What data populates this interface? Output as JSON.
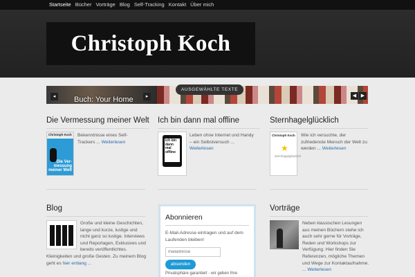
{
  "nav": {
    "items": [
      {
        "label": "Startseite",
        "active": true
      },
      {
        "label": "Bücher"
      },
      {
        "label": "Vorträge"
      },
      {
        "label": "Blog"
      },
      {
        "label": "Self-Tracking"
      },
      {
        "label": "Kontakt"
      },
      {
        "label": "Über mich"
      }
    ]
  },
  "header": {
    "logo_text": "Christoph Koch"
  },
  "slider": {
    "tab_label": "AUSGEWÄHLTE TEXTE",
    "caption": "Buch:  Your Home",
    "prev_icon": "◀",
    "next_icon": "▶",
    "prev_glyph": "◂",
    "next_glyph": "▸"
  },
  "books": [
    {
      "title": "Die Vermessung meiner Welt",
      "text": "Bekenntnisse eines Self-Trackers ... ",
      "more": "Weiterlesen",
      "cover_author": "Christoph Koch",
      "cover_title": "Die Ver-messung meiner Welt"
    },
    {
      "title": "Ich bin dann mal offline",
      "text": "Leben ohne Internet und Handy – ein Selbstversuch ... ",
      "more": "Weiterlesen",
      "cover_title": "ich bin dann mal offline"
    },
    {
      "title": "Sternhagelglücklich",
      "text": "Wie ich versuchte, der zufriedenste Mensch der Welt zu werden ... ",
      "more": "Weiterlesen",
      "cover_author": "Christoph Koch",
      "cover_title": "sternhagelglücklich"
    }
  ],
  "blog": {
    "title": "Blog",
    "text": "Große und kleine Geschichten, lange und kurze, lustige und nicht ganz so lustige. Interviews und Reportagen, Exklusives und bereits veröffentlichtes. Kleinigkeiten und große Gesten. Zu meinem Blog geht es ",
    "link": "hier entlang",
    "after": " ..."
  },
  "subscribe": {
    "title": "Abonnieren",
    "text": "E-Mail-Adresse eintragen und auf dem Laufenden bleiben!",
    "placeholder": "mailadresse",
    "button": "absenden",
    "privacy": "Privatsphäre garantiert - wir geben Ihre"
  },
  "talks": {
    "title": "Vorträge",
    "text": "Neben klassischen Lesungen aus meinen Büchern stehe ich auch sehr gerne für Vorträge, Reden und Workshops zur Verfügung. Hier finden Sie Referenzen, mögliche Themen und Wege zur Kontaktaufnahme. ... ",
    "more": "Weiterlesen"
  },
  "colors": {
    "accent": "#2a6aa8",
    "button": "#1e9ad6",
    "header_bg": "#222222",
    "nav_bg": "#111111"
  }
}
